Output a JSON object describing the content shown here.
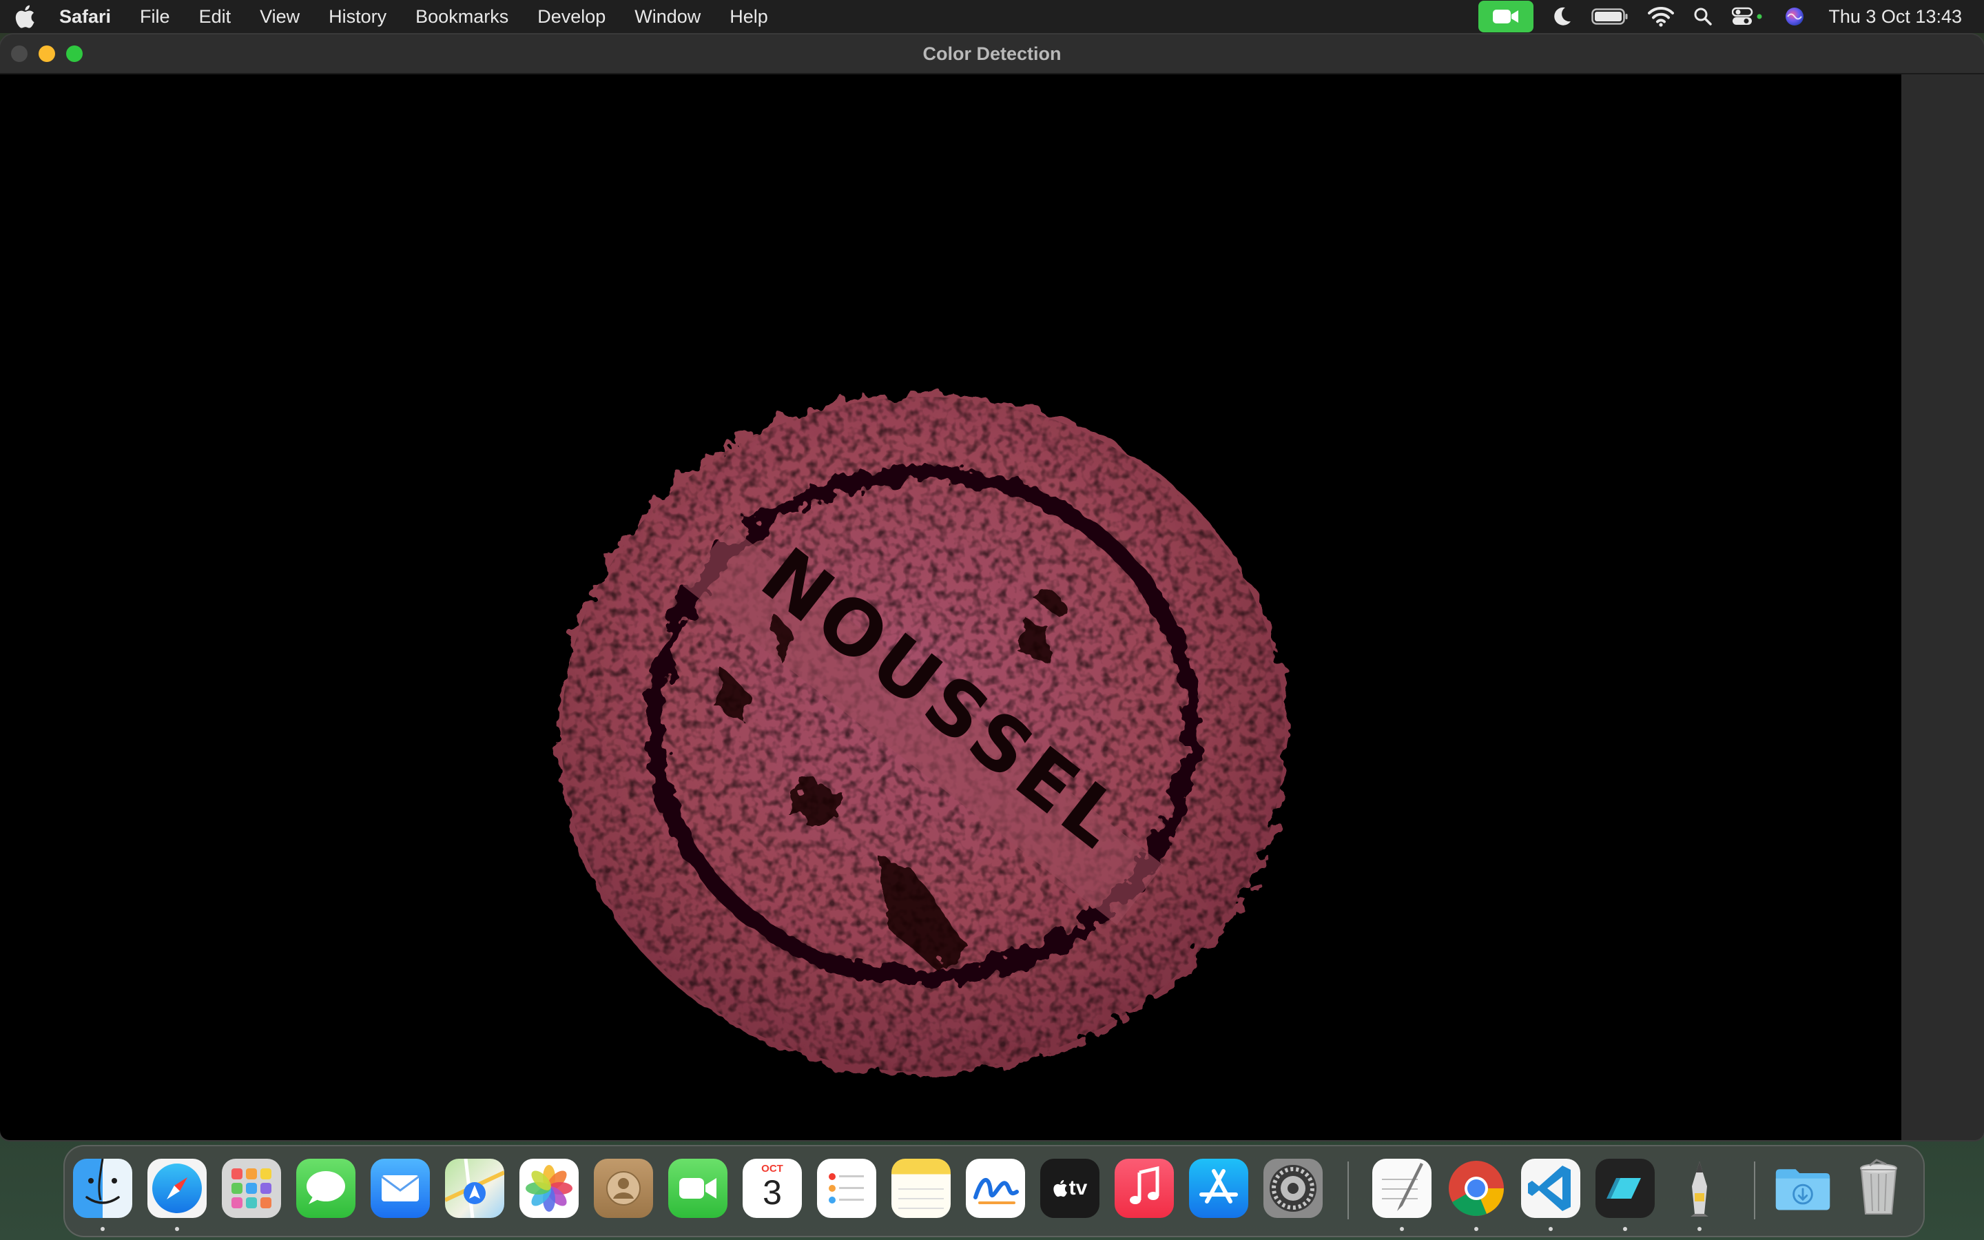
{
  "menubar": {
    "app_name": "Safari",
    "items": [
      "File",
      "Edit",
      "View",
      "History",
      "Bookmarks",
      "Develop",
      "Window",
      "Help"
    ],
    "clock": "Thu 3 Oct  13:43"
  },
  "window": {
    "title": "Color Detection",
    "seal_text": "NOUSSEL",
    "seal_color": "#9c4150"
  },
  "calendar": {
    "month": "OCT",
    "day": "3"
  },
  "dock": {
    "apps": [
      "Finder",
      "Safari",
      "Launchpad",
      "Messages",
      "Mail",
      "Maps",
      "Photos",
      "Contacts",
      "FaceTime",
      "Calendar",
      "Reminders",
      "Notes",
      "Freeform",
      "TV",
      "Music",
      "App Store",
      "System Settings",
      "TextEdit",
      "Google Chrome",
      "Visual Studio Code",
      "Parallels",
      "Pencil",
      "Downloads",
      "Trash"
    ],
    "tv_label": "tv"
  }
}
